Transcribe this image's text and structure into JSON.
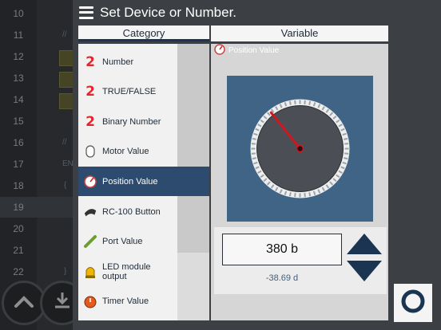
{
  "editor": {
    "lines": [
      {
        "num": "10",
        "frag": ""
      },
      {
        "num": "11",
        "frag": "//"
      },
      {
        "num": "12",
        "frag": ""
      },
      {
        "num": "13",
        "frag": ""
      },
      {
        "num": "14",
        "frag": ""
      },
      {
        "num": "15",
        "frag": ""
      },
      {
        "num": "16",
        "frag": "//"
      },
      {
        "num": "17",
        "frag": "EN"
      },
      {
        "num": "18",
        "frag": "{"
      },
      {
        "num": "19",
        "frag": ""
      },
      {
        "num": "20",
        "frag": ""
      },
      {
        "num": "21",
        "frag": ""
      },
      {
        "num": "22",
        "frag": "}"
      }
    ],
    "active_line": "19"
  },
  "dialog": {
    "title": "Set Device or Number.",
    "category_header": "Category",
    "variable_header": "Variable",
    "categories": [
      {
        "label": "Number",
        "icon": "number-icon"
      },
      {
        "label": "TRUE/FALSE",
        "icon": "number-icon"
      },
      {
        "label": "Binary Number",
        "icon": "number-icon"
      },
      {
        "label": "Motor Value",
        "icon": "motor-icon"
      },
      {
        "label": "Position Value",
        "icon": "position-icon"
      },
      {
        "label": "RC-100 Button",
        "icon": "remote-icon"
      },
      {
        "label": "Port Value",
        "icon": "port-icon"
      },
      {
        "label": "LED module output",
        "icon": "led-icon"
      },
      {
        "label": "Timer Value",
        "icon": "timer-icon"
      }
    ],
    "selected_category": "Position Value",
    "variable": {
      "subtitle": "Position Value",
      "value_text": "380 b",
      "degree_text": "-38.69 d",
      "gauge_fraction": 0.371
    },
    "ok_icon": "circle-o-icon"
  },
  "colors": {
    "accent_navy": "#1b3452",
    "selected_row": "#2d4b6e",
    "gauge_bg": "#3f6485",
    "needle": "#d0171f",
    "number_icon_red": "#e4252b"
  }
}
